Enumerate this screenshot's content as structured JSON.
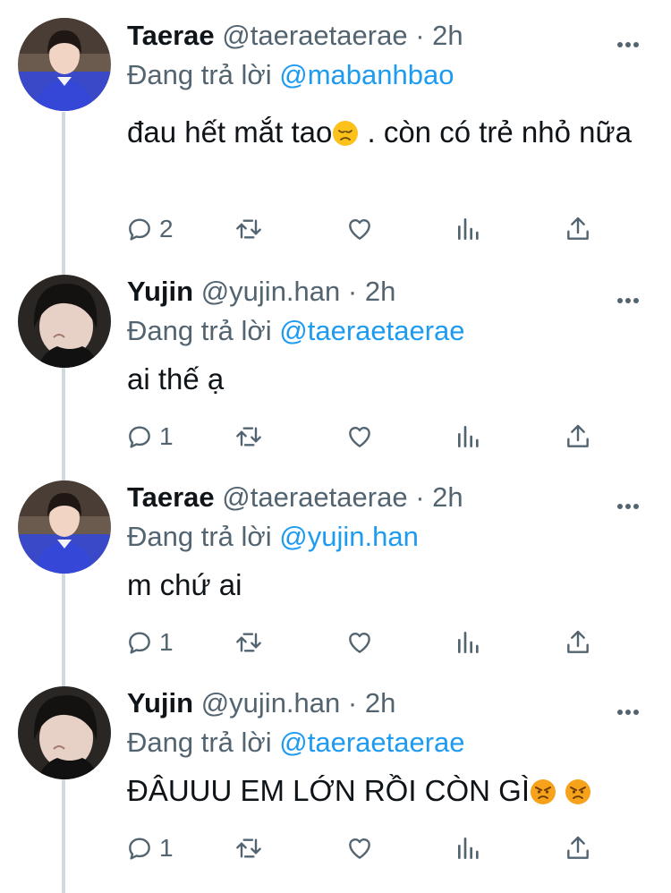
{
  "tweets": [
    {
      "name": "Taerae",
      "handle": "@taeraetaerae",
      "sep": "·",
      "time": "2h",
      "reply_prefix": "Đang trả lời",
      "reply_to": "@mabanhbao",
      "text": "đau hết mắt tao",
      "text_tail": " . còn có trẻ nhỏ nữa",
      "emoji": [
        "disappointed-face"
      ],
      "replies": "2",
      "avatar": "taerae"
    },
    {
      "name": "Yujin",
      "handle": "@yujin.han",
      "sep": "·",
      "time": "2h",
      "reply_prefix": "Đang trả lời",
      "reply_to": "@taeraetaerae",
      "text": "ai thế ạ",
      "replies": "1",
      "avatar": "yujin"
    },
    {
      "name": "Taerae",
      "handle": "@taeraetaerae",
      "sep": "·",
      "time": "2h",
      "reply_prefix": "Đang trả lời",
      "reply_to": "@yujin.han",
      "text": "m chứ ai",
      "replies": "1",
      "avatar": "taerae"
    },
    {
      "name": "Yujin",
      "handle": "@yujin.han",
      "sep": "·",
      "time": "2h",
      "reply_prefix": "Đang trả lời",
      "reply_to": "@taeraetaerae",
      "text": "ĐÂUUU EM LỚN RỒI CÒN GÌ",
      "emoji": [
        "angry-face",
        "angry-face"
      ],
      "replies": "1",
      "avatar": "yujin"
    }
  ],
  "colors": {
    "link": "#1d9bf0",
    "meta": "#536471",
    "thread": "#cfd9de"
  },
  "icons": [
    "reply-icon",
    "retweet-icon",
    "like-icon",
    "views-icon",
    "share-icon",
    "more-icon"
  ]
}
